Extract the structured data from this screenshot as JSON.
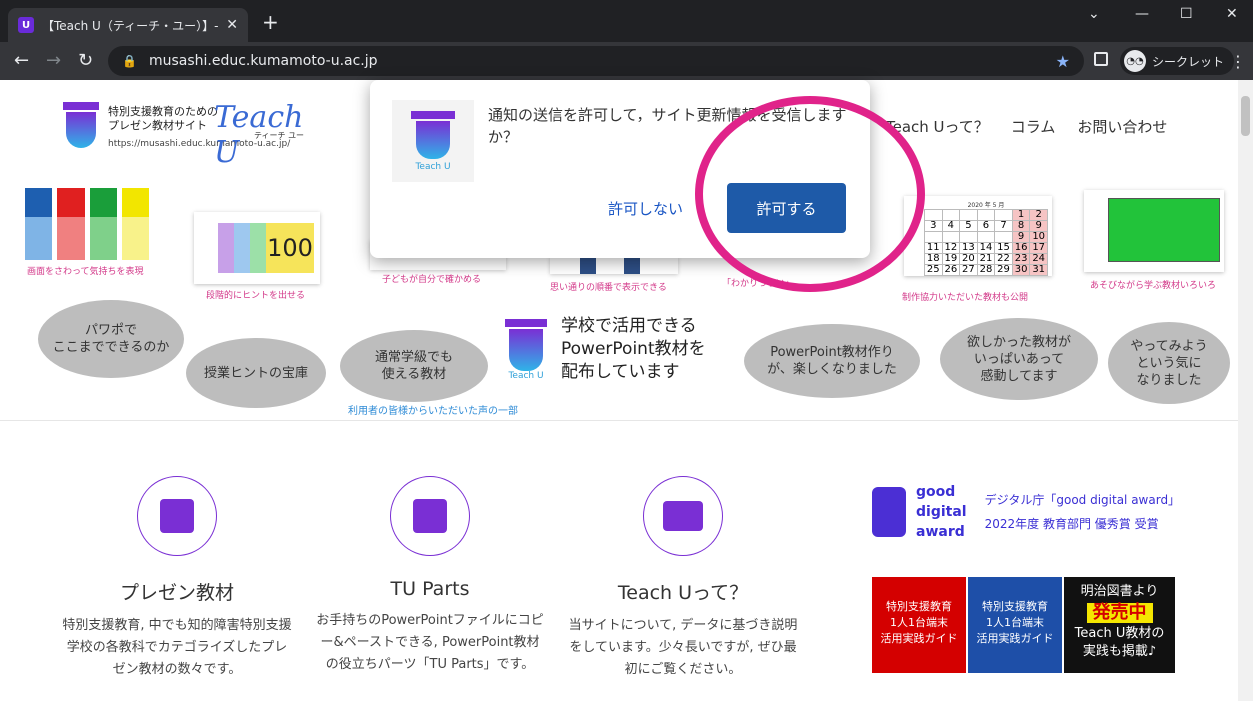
{
  "browser": {
    "tab_title": "【Teach U（ティーチ・ユー）】- [Teac",
    "url": "musashi.educ.kumamoto-u.ac.jp",
    "incognito_label": "シークレット"
  },
  "site": {
    "logo_line1": "特別支援教育のための",
    "logo_line2": "プレゼン教材サイト",
    "logo_script": "Teach U",
    "logo_script_sub": "ティーチ ユー",
    "logo_url": "https://musashi.educ.kumamoto-u.ac.jp/",
    "nav": [
      "Teach Uって？",
      "コラム",
      "お問い合わせ"
    ]
  },
  "thumbnails": [
    {
      "caption": "画面をさわって気持ちを表現"
    },
    {
      "caption": "段階的にヒントを出せる",
      "number": "100"
    },
    {
      "caption": "子どもが自分で確かめる"
    },
    {
      "caption": "思い通りの順番で表示できる"
    },
    {
      "caption": "「わかりづらい」"
    },
    {
      "caption": "制作協力いただいた教材も公開",
      "calendar_title": "2020 年 5 月"
    },
    {
      "caption": "あそびながら学ぶ教材いろいろ"
    }
  ],
  "calendar": {
    "rows": [
      [
        "",
        "",
        "",
        "",
        "",
        "1",
        "2"
      ],
      [
        "3",
        "4",
        "5",
        "6",
        "7",
        "8",
        "9"
      ],
      [
        "",
        "",
        "",
        "",
        "",
        "9",
        "10"
      ],
      [
        "11",
        "12",
        "13",
        "14",
        "15",
        "16",
        "17"
      ],
      [
        "18",
        "19",
        "20",
        "21",
        "22",
        "23",
        "24"
      ],
      [
        "25",
        "26",
        "27",
        "28",
        "29",
        "30",
        "31"
      ]
    ]
  },
  "testimonials": [
    "パワポで\nここまでできるのか",
    "授業ヒントの宝庫",
    "通常学級でも\n使える教材",
    "PowerPoint教材作り\nが、楽しくなりました",
    "欲しかった教材が\nいっぱいあって\n感動してます",
    "やってみよう\nという気に\nなりました"
  ],
  "center_message": "学校で活用できる\nPowerPoint教材を\n配布しています",
  "logo_small_label": "Teach U",
  "voice_note": "利用者の皆様からいただいた声の一部",
  "cards": [
    {
      "title": "プレゼン教材",
      "desc": "特別支援教育, 中でも知的障害特別支援学校の各教科でカテゴライズしたプレゼン教材の数々です。"
    },
    {
      "title": "TU Parts",
      "desc": "お手持ちのPowerPointファイルにコピー&ペーストできる, PowerPoint教材の役立ちパーツ「TU Parts」です。"
    },
    {
      "title": "Teach Uって？",
      "desc": "当サイトについて, データに基づき説明をしています。少々長いですが, ぜひ最初にご覧ください。"
    }
  ],
  "award": {
    "logo_lines": [
      "good",
      "digital",
      "award"
    ],
    "line1": "デジタル庁「good digital award」",
    "line2": "2022年度 教育部門 優秀賞 受賞"
  },
  "banner": {
    "book_title": "特別支援教育\n1人1台端末\n活用実践ガイド",
    "publisher": "明治図書より",
    "sale": "発売中",
    "note": "Teach U教材の\n実践も掲載♪"
  },
  "popup": {
    "message": "通知の送信を許可して，サイト更新情報を受信しますか？",
    "deny_label": "許可しない",
    "allow_label": "許可する",
    "icon_label": "Teach U"
  },
  "colors": {
    "brand_purple": "#7a2fd4",
    "accent_pink": "#e0238a",
    "allow_blue": "#1e5aa8"
  }
}
